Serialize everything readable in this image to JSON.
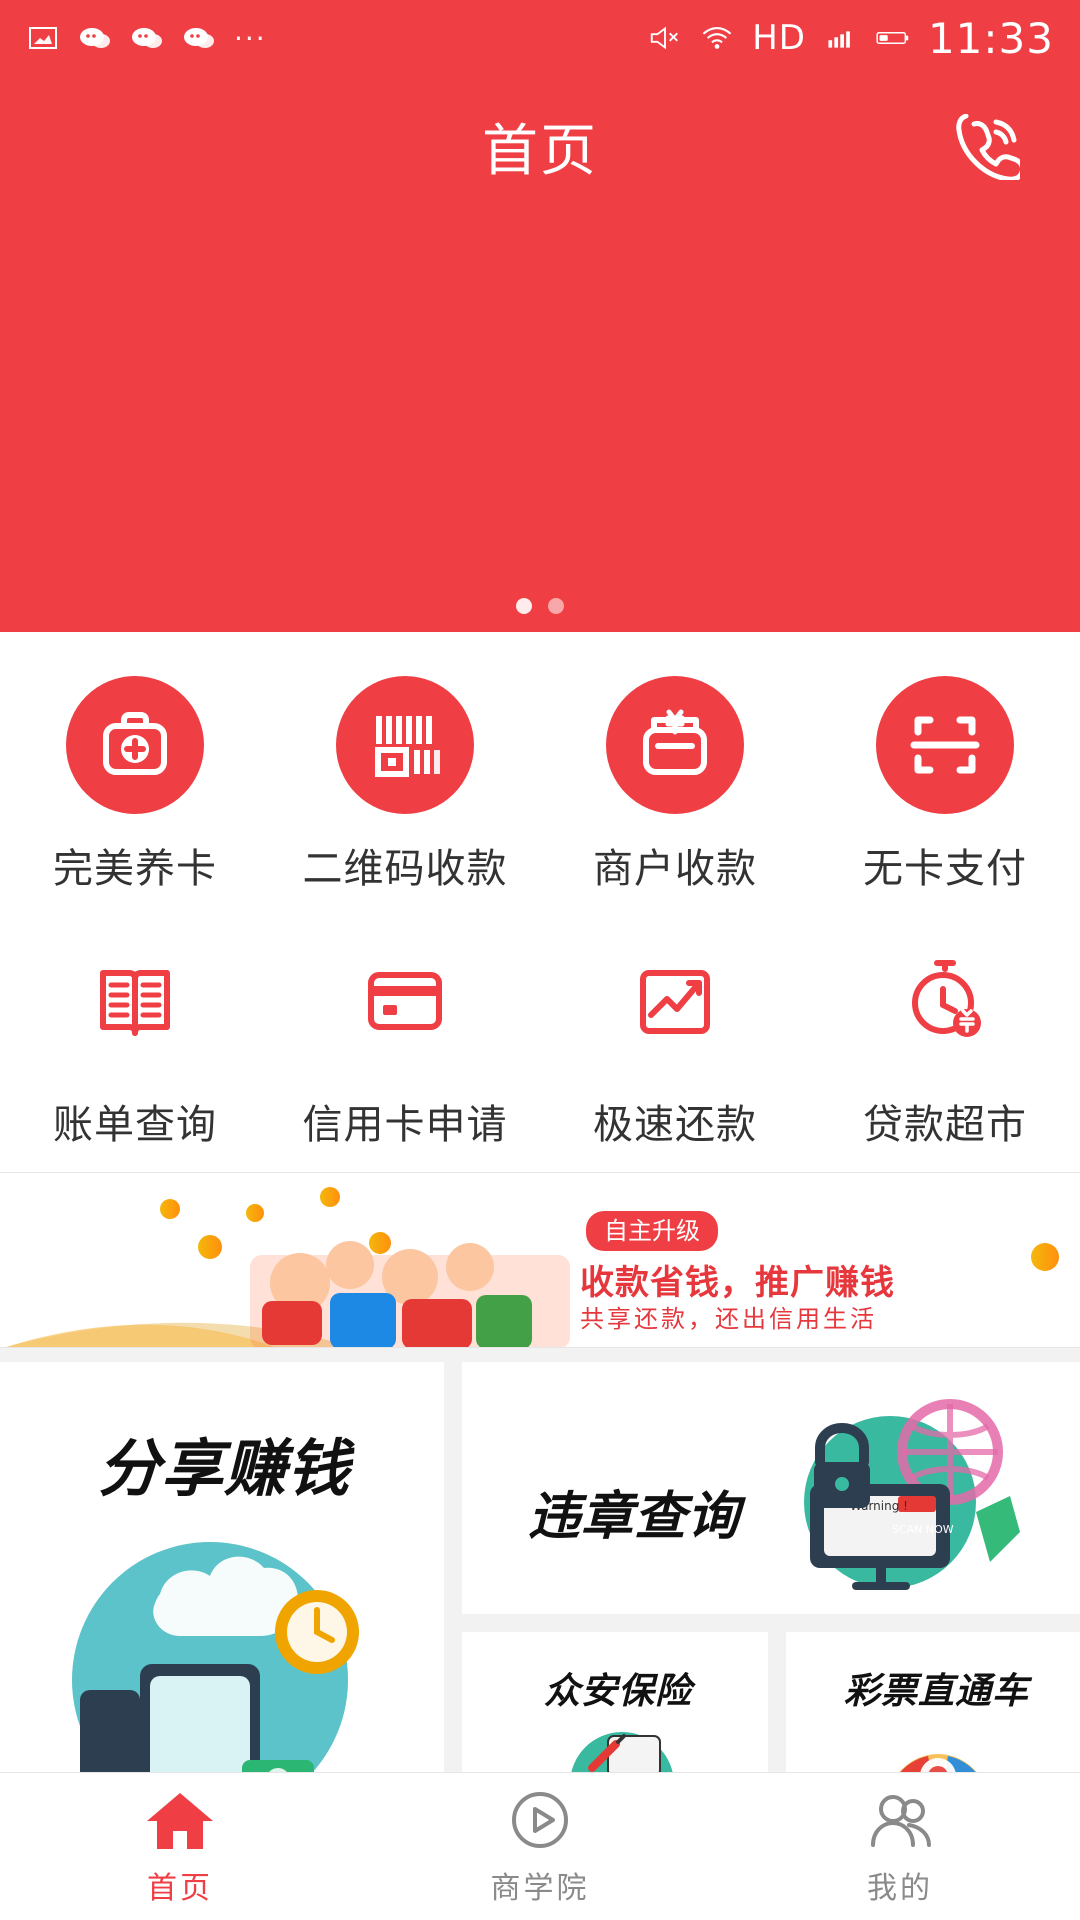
{
  "statusbar": {
    "right_hd": "HD",
    "time": "11:33",
    "more": "···"
  },
  "header": {
    "title": "首页",
    "phone_icon": "phone-icon"
  },
  "banner": {
    "dots_total": 2,
    "active_index": 0
  },
  "quick_menu": {
    "row1": [
      {
        "label": "完美养卡",
        "icon": "medical-kit-icon"
      },
      {
        "label": "二维码收款",
        "icon": "barcode-qr-icon"
      },
      {
        "label": "商户收款",
        "icon": "wallet-yen-icon"
      },
      {
        "label": "无卡支付",
        "icon": "scan-frame-icon"
      }
    ],
    "row2": [
      {
        "label": "账单查询",
        "icon": "book-icon"
      },
      {
        "label": "信用卡申请",
        "icon": "credit-card-icon"
      },
      {
        "label": "极速还款",
        "icon": "trend-up-icon"
      },
      {
        "label": "贷款超市",
        "icon": "clock-yen-icon"
      }
    ]
  },
  "promo": {
    "badge": "自主升级",
    "title": "收款省钱，推广赚钱",
    "subtitle": "共享还款，还出信用生活"
  },
  "cards": {
    "share_title": "分享赚钱",
    "violation_title": "违章查询",
    "insurance_title": "众安保险",
    "lottery_title": "彩票直通车",
    "violation_art_warning": "Warning !",
    "violation_art_scan": "SCAN NOW"
  },
  "bottom_nav": [
    {
      "label": "首页",
      "icon": "home-icon",
      "active": true
    },
    {
      "label": "商学院",
      "icon": "play-circle-icon",
      "active": false
    },
    {
      "label": "我的",
      "icon": "users-icon",
      "active": false
    }
  ],
  "colors": {
    "brand_red": "#ef3f44",
    "white": "#ffffff",
    "gray": "#8a8a8a"
  }
}
